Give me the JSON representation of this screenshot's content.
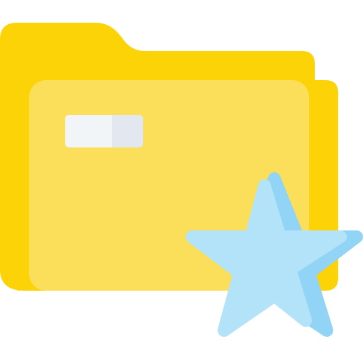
{
  "icon": {
    "name": "favorite-folder-icon",
    "parts": {
      "folder": "folder-icon",
      "label": "folder-label-tag",
      "star": "star-icon"
    }
  },
  "colors": {
    "folder_back": "#FBD307",
    "folder_front": "#FBDF5A",
    "label_left": "#F2F5F8",
    "label_right": "#E2E7F0",
    "star_main": "#B3E3F8",
    "star_shade": "#92D4F5"
  }
}
